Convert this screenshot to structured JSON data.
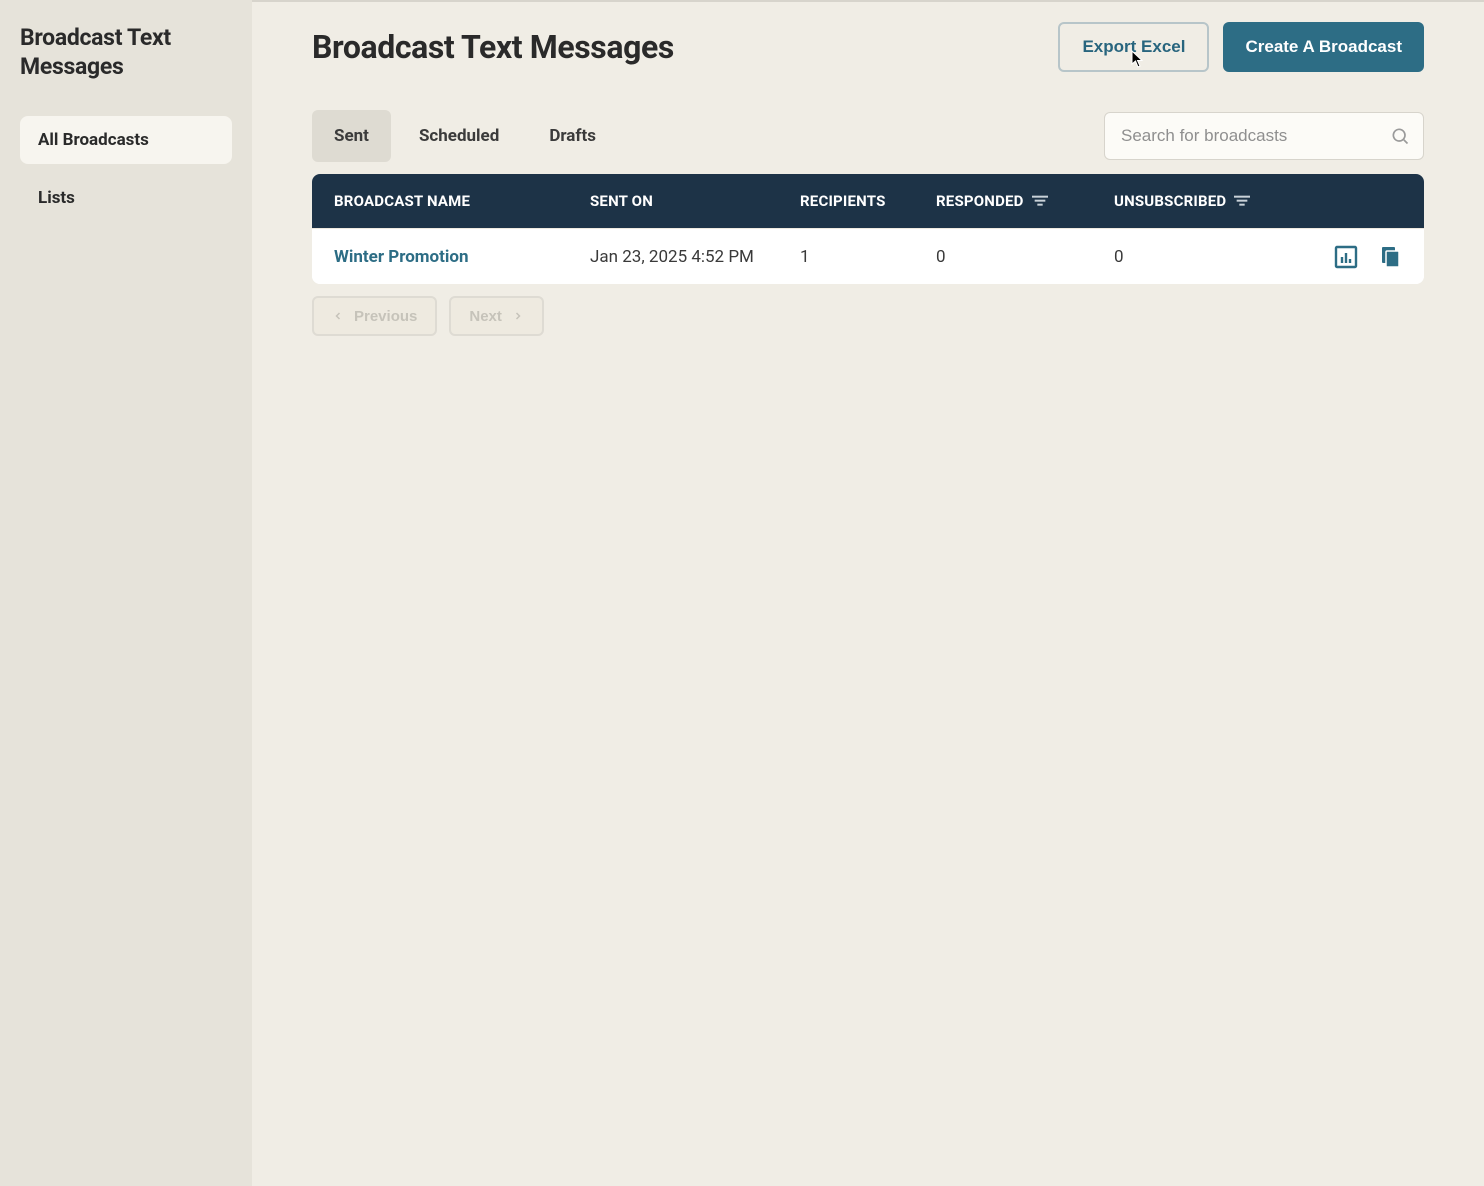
{
  "sidebar": {
    "title": "Broadcast Text Messages",
    "items": [
      {
        "label": "All Broadcasts",
        "active": true
      },
      {
        "label": "Lists",
        "active": false
      }
    ]
  },
  "header": {
    "title": "Broadcast Text Messages",
    "export_label": "Export Excel",
    "create_label": "Create A Broadcast"
  },
  "tabs": [
    {
      "label": "Sent",
      "active": true
    },
    {
      "label": "Scheduled",
      "active": false
    },
    {
      "label": "Drafts",
      "active": false
    }
  ],
  "search": {
    "placeholder": "Search for broadcasts"
  },
  "table": {
    "columns": {
      "name": "BROADCAST NAME",
      "sent_on": "SENT ON",
      "recipients": "RECIPIENTS",
      "responded": "RESPONDED",
      "unsubscribed": "UNSUBSCRIBED"
    },
    "rows": [
      {
        "name": "Winter Promotion",
        "sent_on": "Jan 23, 2025 4:52 PM",
        "recipients": "1",
        "responded": "0",
        "unsubscribed": "0"
      }
    ]
  },
  "pagination": {
    "previous": "Previous",
    "next": "Next"
  }
}
